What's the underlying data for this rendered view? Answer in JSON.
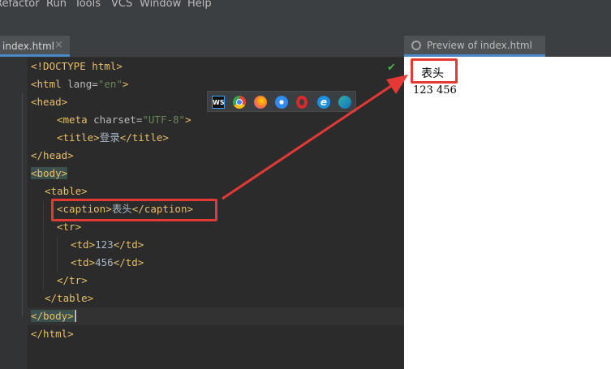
{
  "menu": [
    "Refactor",
    "Run",
    "Tools",
    "VCS",
    "Window",
    "Help"
  ],
  "editor_tab": {
    "label": "index.html",
    "close": "×"
  },
  "preview_tab": {
    "label": "Preview of index.html"
  },
  "code": {
    "l1": "<!DOCTYPE html>",
    "l2_tag_open": "<html ",
    "l2_attr": "lang=",
    "l2_str": "\"en\"",
    "l2_tag_close": ">",
    "l3": "<head>",
    "l4_tag": "<meta ",
    "l4_attr": "charset=",
    "l4_str": "\"UTF-8\"",
    "l4_end": ">",
    "l5_open": "<title>",
    "l5_text": "登录",
    "l5_close": "</title>",
    "l6": "</head>",
    "l7": "<body>",
    "l8": "<table>",
    "l9_open": "<caption>",
    "l9_text": "表头",
    "l9_close": "</caption>",
    "l10": "<tr>",
    "l11_open": "<td>",
    "l11_text": "123",
    "l11_close": "</td>",
    "l12_open": "<td>",
    "l12_text": "456",
    "l12_close": "</td>",
    "l13": "</tr>",
    "l14": "</table>",
    "l15": "</body>",
    "l16": "</html>"
  },
  "browsers": [
    {
      "name": "webstorm",
      "abbr": "WS",
      "color": "#1e2a44"
    },
    {
      "name": "chrome",
      "abbr": "",
      "color": "#4caf50"
    },
    {
      "name": "firefox",
      "abbr": "",
      "color": "#ff7139"
    },
    {
      "name": "safari",
      "abbr": "",
      "color": "#2f8cf0"
    },
    {
      "name": "opera",
      "abbr": "",
      "color": "#e0282c"
    },
    {
      "name": "ie",
      "abbr": "e",
      "color": "#1b8fe0"
    },
    {
      "name": "edge",
      "abbr": "",
      "color": "#2db4a5"
    }
  ],
  "preview": {
    "caption": "表头",
    "row": "123 456"
  },
  "accent": "#e53935"
}
